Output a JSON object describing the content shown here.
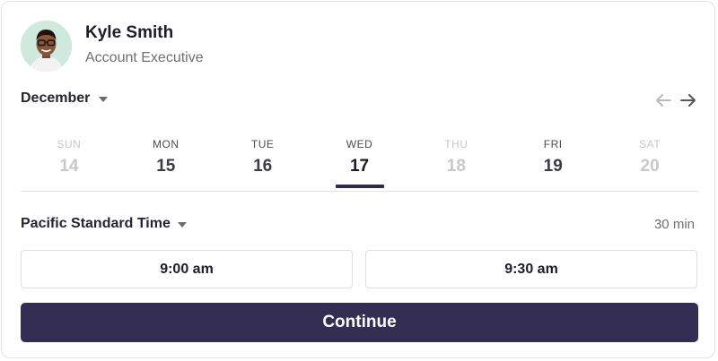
{
  "profile": {
    "name": "Kyle Smith",
    "title": "Account Executive"
  },
  "calendar": {
    "month": "December",
    "prev_icon": "arrow-left-icon",
    "next_icon": "arrow-right-icon",
    "days": [
      {
        "dow": "SUN",
        "date": "14",
        "state": "disabled"
      },
      {
        "dow": "MON",
        "date": "15",
        "state": "available"
      },
      {
        "dow": "TUE",
        "date": "16",
        "state": "available"
      },
      {
        "dow": "WED",
        "date": "17",
        "state": "selected"
      },
      {
        "dow": "THU",
        "date": "18",
        "state": "disabled"
      },
      {
        "dow": "FRI",
        "date": "19",
        "state": "available"
      },
      {
        "dow": "SAT",
        "date": "20",
        "state": "disabled"
      }
    ]
  },
  "timezone": {
    "label": "Pacific Standard Time",
    "duration": "30 min"
  },
  "slots": [
    "9:00 am",
    "9:30 am"
  ],
  "actions": {
    "continue_label": "Continue"
  },
  "colors": {
    "primary": "#352e54",
    "selected_underline": "#302a4c",
    "disabled_text": "#c7c7cc",
    "avatar_bg": "#cfe9dc"
  }
}
